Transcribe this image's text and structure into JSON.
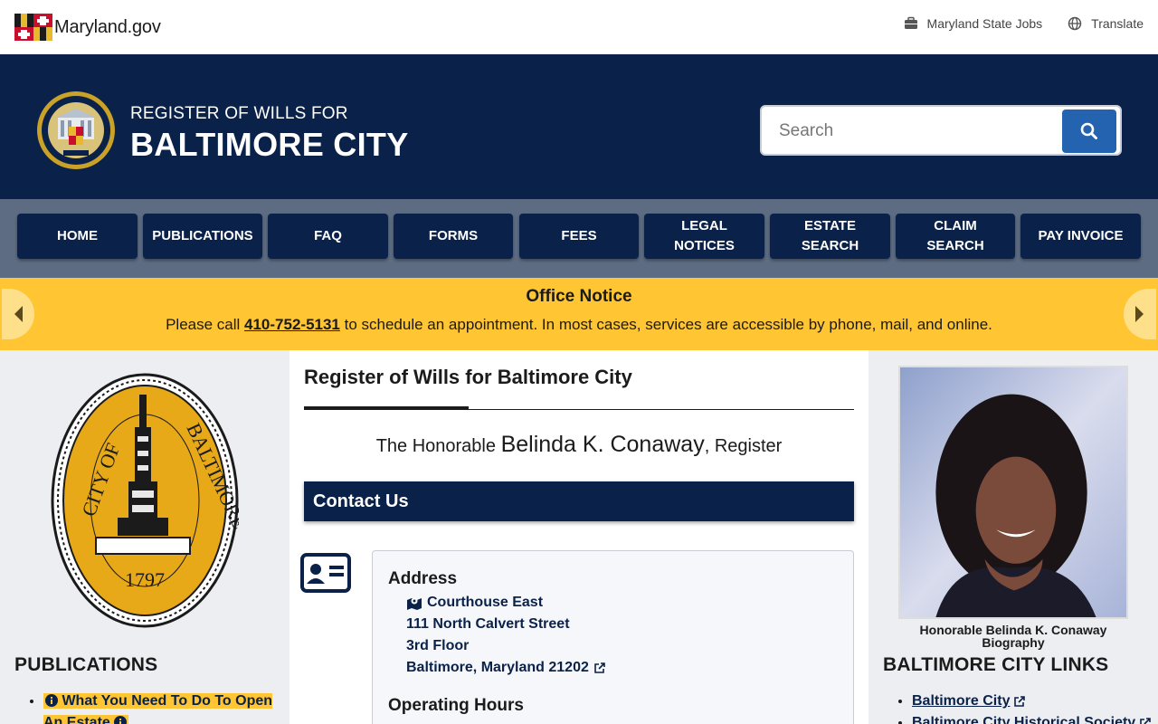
{
  "utility": {
    "brand": "Maryland.gov",
    "jobs_label": "Maryland State Jobs",
    "translate_label": "Translate"
  },
  "header": {
    "subtitle": "REGISTER OF WILLS FOR",
    "title": "BALTIMORE CITY",
    "search_placeholder": "Search"
  },
  "nav": {
    "items": [
      {
        "label": "HOME"
      },
      {
        "label": "PUBLICATIONS"
      },
      {
        "label": "FAQ"
      },
      {
        "label": "FORMS"
      },
      {
        "label": "FEES"
      },
      {
        "label": "LEGAL NOTICES"
      },
      {
        "label": "ESTATE SEARCH"
      },
      {
        "label": "CLAIM SEARCH"
      },
      {
        "label": "PAY INVOICE"
      }
    ]
  },
  "alert": {
    "title": "Office Notice",
    "before": "Please call ",
    "phone": "410-752-5131",
    "after": " to schedule an appointment. In most cases, services are accessible by phone, mail, and online."
  },
  "left": {
    "seal_text": "CITY OF BALTIMORE",
    "seal_year": "1797",
    "heading": "PUBLICATIONS",
    "items": [
      {
        "label": "What You Need To Do To Open An Estate"
      }
    ]
  },
  "main": {
    "title": "Register of Wills for Baltimore City",
    "honorable_prefix": "The Honorable ",
    "honorable_name": "Belinda K. Conaway",
    "honorable_suffix": ", Register",
    "contact_heading": "Contact Us",
    "address_heading": "Address",
    "address_lines": [
      "Courthouse East",
      "111 North Calvert Street",
      "3rd Floor",
      "Baltimore, Maryland 21202"
    ],
    "hours_heading": "Operating Hours"
  },
  "right": {
    "caption_line1": "Honorable Belinda K. Conaway",
    "caption_line2": "Biography",
    "heading": "BALTIMORE CITY LINKS",
    "links": [
      {
        "label": "Baltimore City"
      },
      {
        "label": "Baltimore City Historical Society"
      }
    ]
  },
  "colors": {
    "navy": "#0a2249",
    "slate": "#5d6c82",
    "gold": "#ffc533",
    "search_blue": "#2463b0"
  },
  "icons": [
    "maryland-flag-icon",
    "briefcase-icon",
    "globe-icon",
    "search-icon",
    "chevron-left-icon",
    "chevron-right-icon",
    "contact-card-icon",
    "map-icon",
    "external-link-icon",
    "info-icon"
  ]
}
